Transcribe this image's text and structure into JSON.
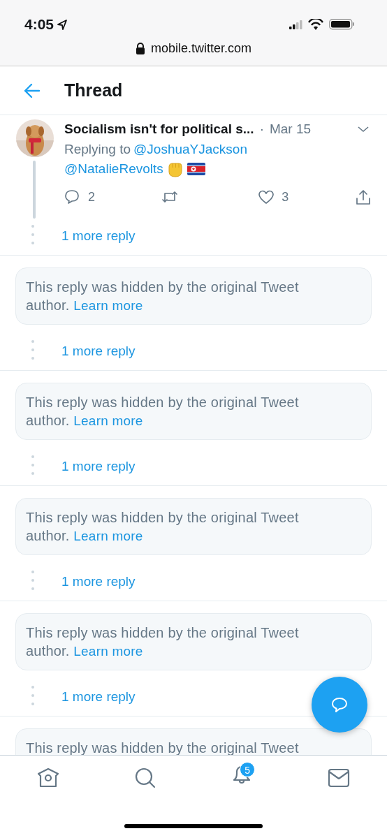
{
  "status_bar": {
    "time": "4:05",
    "url": "mobile.twitter.com"
  },
  "header": {
    "title": "Thread"
  },
  "tweet": {
    "author": "Socialism isn't for political s...",
    "date_separator": "·",
    "date": "Mar 15",
    "replying_label": "Replying to",
    "mentions": [
      "@JoshuaYJackson",
      "@NatalieRevolts"
    ],
    "actions": [
      {
        "kind": "reply",
        "count": "2"
      },
      {
        "kind": "retweet"
      },
      {
        "kind": "like",
        "count": "3"
      },
      {
        "kind": "share"
      }
    ]
  },
  "thread": [
    {
      "kind": "more",
      "label": "1 more reply"
    },
    {
      "kind": "hidden",
      "text": "This reply was hidden by the original Tweet author.",
      "link": "Learn more"
    },
    {
      "kind": "more",
      "label": "1 more reply"
    },
    {
      "kind": "hidden",
      "text": "This reply was hidden by the original Tweet author.",
      "link": "Learn more"
    },
    {
      "kind": "more",
      "label": "1 more reply"
    },
    {
      "kind": "hidden",
      "text": "This reply was hidden by the original Tweet author.",
      "link": "Learn more"
    },
    {
      "kind": "more",
      "label": "1 more reply"
    },
    {
      "kind": "hidden",
      "text": "This reply was hidden by the original Tweet author.",
      "link": "Learn more"
    },
    {
      "kind": "more",
      "label": "1 more reply"
    },
    {
      "kind": "hidden",
      "text": "This reply was hidden by the original Tweet"
    }
  ],
  "tab_bar": [
    {
      "kind": "home"
    },
    {
      "kind": "search"
    },
    {
      "kind": "notifications",
      "badge": "5"
    },
    {
      "kind": "messages"
    }
  ]
}
